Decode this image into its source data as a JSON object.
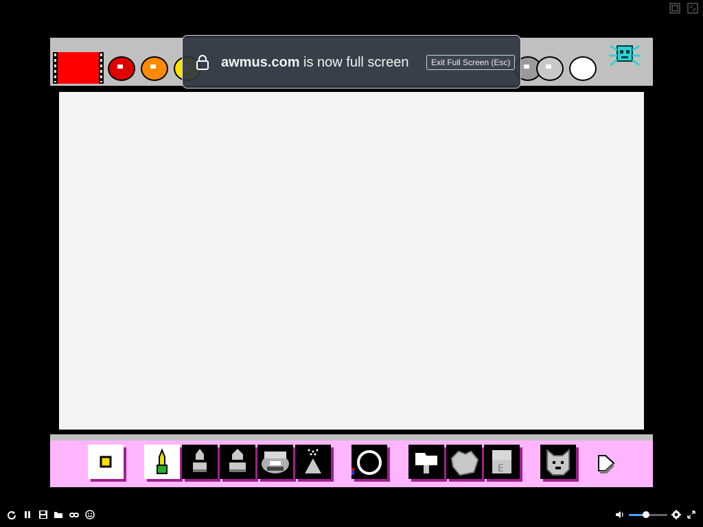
{
  "browser": {
    "fullscreen_notice": {
      "domain": "awmus.com",
      "message": " is now full screen",
      "exit_button": "Exit Full Screen (Esc)"
    }
  },
  "paint_app": {
    "current_color": "#ff0000",
    "palette": [
      {
        "name": "red",
        "color": "#e00000"
      },
      {
        "name": "orange",
        "color": "#ff8a00"
      },
      {
        "name": "yellow",
        "color": "#ffe000"
      },
      {
        "name": "gray",
        "color": "#9a9a9a"
      },
      {
        "name": "light-gray",
        "color": "#c8c8c8"
      },
      {
        "name": "white",
        "color": "#ffffff"
      }
    ],
    "toolbar_accent": "#a0208c",
    "toolbar_bg": "#ffb6ff"
  },
  "player": {
    "volume": 0.45
  }
}
